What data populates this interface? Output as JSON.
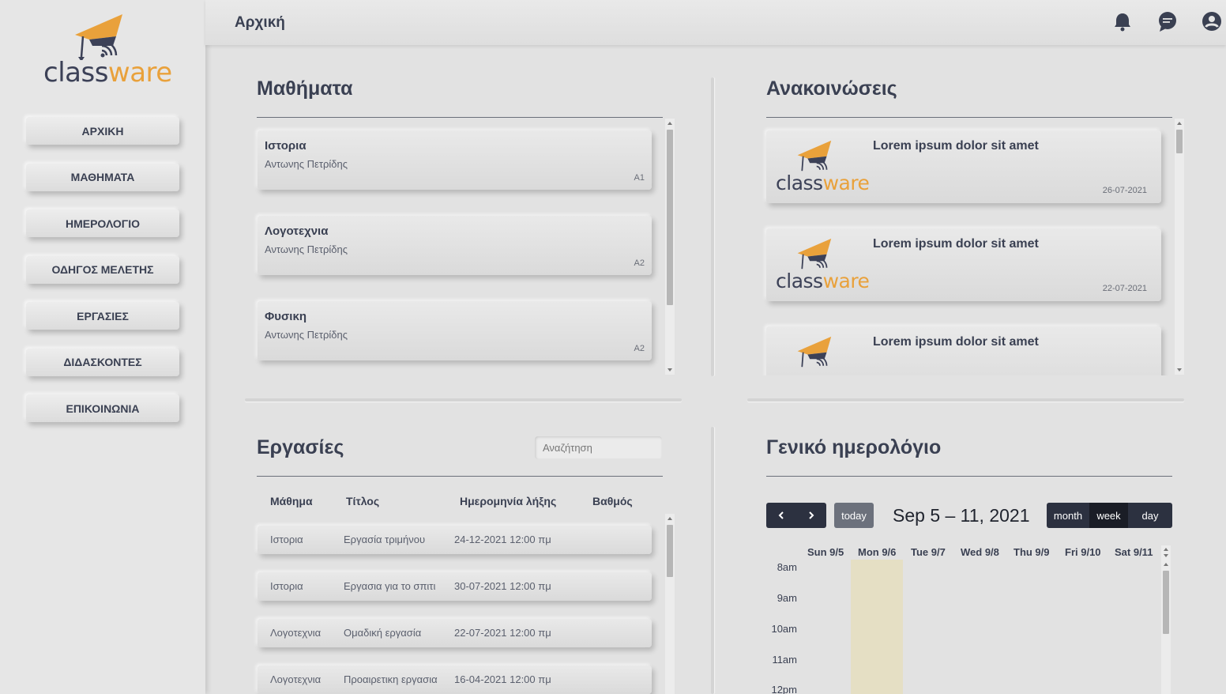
{
  "app": {
    "logo_a": "class",
    "logo_b": "ware"
  },
  "sidebar": {
    "items": [
      {
        "label": "ΑΡΧΙΚΗ"
      },
      {
        "label": "ΜΑΘΗΜΑΤΑ"
      },
      {
        "label": "ΗΜΕΡΟΛΟΓΙΟ"
      },
      {
        "label": "ΟΔΗΓΟΣ ΜΕΛΕΤΗΣ"
      },
      {
        "label": "ΕΡΓΑΣΙΕΣ"
      },
      {
        "label": "ΔΙΔΑΣΚΟΝΤΕΣ"
      },
      {
        "label": "ΕΠΙΚΟΙΝΩΝΙΑ"
      }
    ]
  },
  "header": {
    "title": "Αρχική",
    "icons": [
      "bell-icon",
      "chat-icon",
      "user-account-icon"
    ]
  },
  "courses": {
    "title": "Μαθήματα",
    "items": [
      {
        "name": "Ιστορια",
        "teacher": "Αντωνης Πετρίδης",
        "class": "A1"
      },
      {
        "name": "Λογοτεχνια",
        "teacher": "Αντωνης Πετρίδης",
        "class": "A2"
      },
      {
        "name": "Φυσικη",
        "teacher": "Αντωνης Πετρίδης",
        "class": "A2"
      }
    ]
  },
  "announcements": {
    "title": "Ανακοινώσεις",
    "items": [
      {
        "title": "Lorem ipsum dolor sit amet",
        "date": "26-07-2021"
      },
      {
        "title": "Lorem ipsum dolor sit amet",
        "date": "22-07-2021"
      },
      {
        "title": "Lorem ipsum dolor sit amet",
        "date": ""
      }
    ]
  },
  "assignments": {
    "title": "Εργασίες",
    "search_placeholder": "Αναζήτηση",
    "columns": [
      "Μάθημα",
      "Τίτλος",
      "Ημερομηνία λήξης",
      "Βαθμός"
    ],
    "rows": [
      {
        "course": "Ιστορια",
        "title": "Εργασία τριμήνου",
        "due": "24-12-2021 12:00 πμ",
        "grade": ""
      },
      {
        "course": "Ιστορια",
        "title": "Εργασια για το σπιτι",
        "due": "30-07-2021 12:00 πμ",
        "grade": ""
      },
      {
        "course": "Λογοτεχνια",
        "title": "Ομαδική εργασία",
        "due": "22-07-2021 12:00 πμ",
        "grade": ""
      },
      {
        "course": "Λογοτεχνια",
        "title": "Προαιρετικη εργασια",
        "due": "16-04-2021 12:00 πμ",
        "grade": ""
      }
    ]
  },
  "calendar": {
    "title": "Γενικό ημερολόγιο",
    "today_label": "today",
    "range": "Sep 5 – 11, 2021",
    "views": [
      "month",
      "week",
      "day"
    ],
    "active_view": "week",
    "days": [
      "Sun 9/5",
      "Mon 9/6",
      "Tue 9/7",
      "Wed 9/8",
      "Thu 9/9",
      "Fri 9/10",
      "Sat 9/11"
    ],
    "times": [
      "8am",
      "9am",
      "10am",
      "11am",
      "12pm"
    ],
    "colors": {
      "toolbar": "#2c3140",
      "active_view": "#1a1d26",
      "today_button": "#6c717c",
      "today_highlight": "#e5dfc4"
    }
  }
}
